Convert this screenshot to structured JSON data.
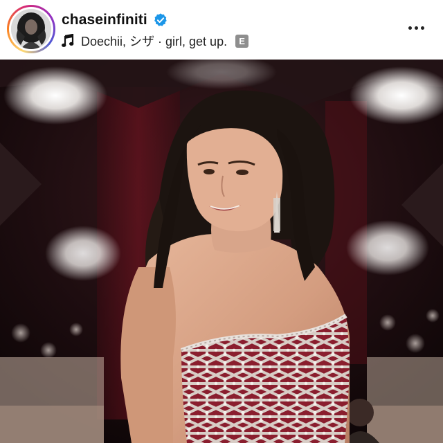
{
  "post": {
    "username": "chaseinfiniti",
    "verified": true,
    "audio_track": "Doechii, シザ · girl, get up.",
    "explicit_label": "E",
    "more_options_icon": "more-horizontal-icon",
    "music_icon": "music-note-icon",
    "verified_icon": "verified-badge-icon",
    "accent_color": "#1c96e8"
  },
  "photo": {
    "subject": "red-carpet-portrait"
  }
}
